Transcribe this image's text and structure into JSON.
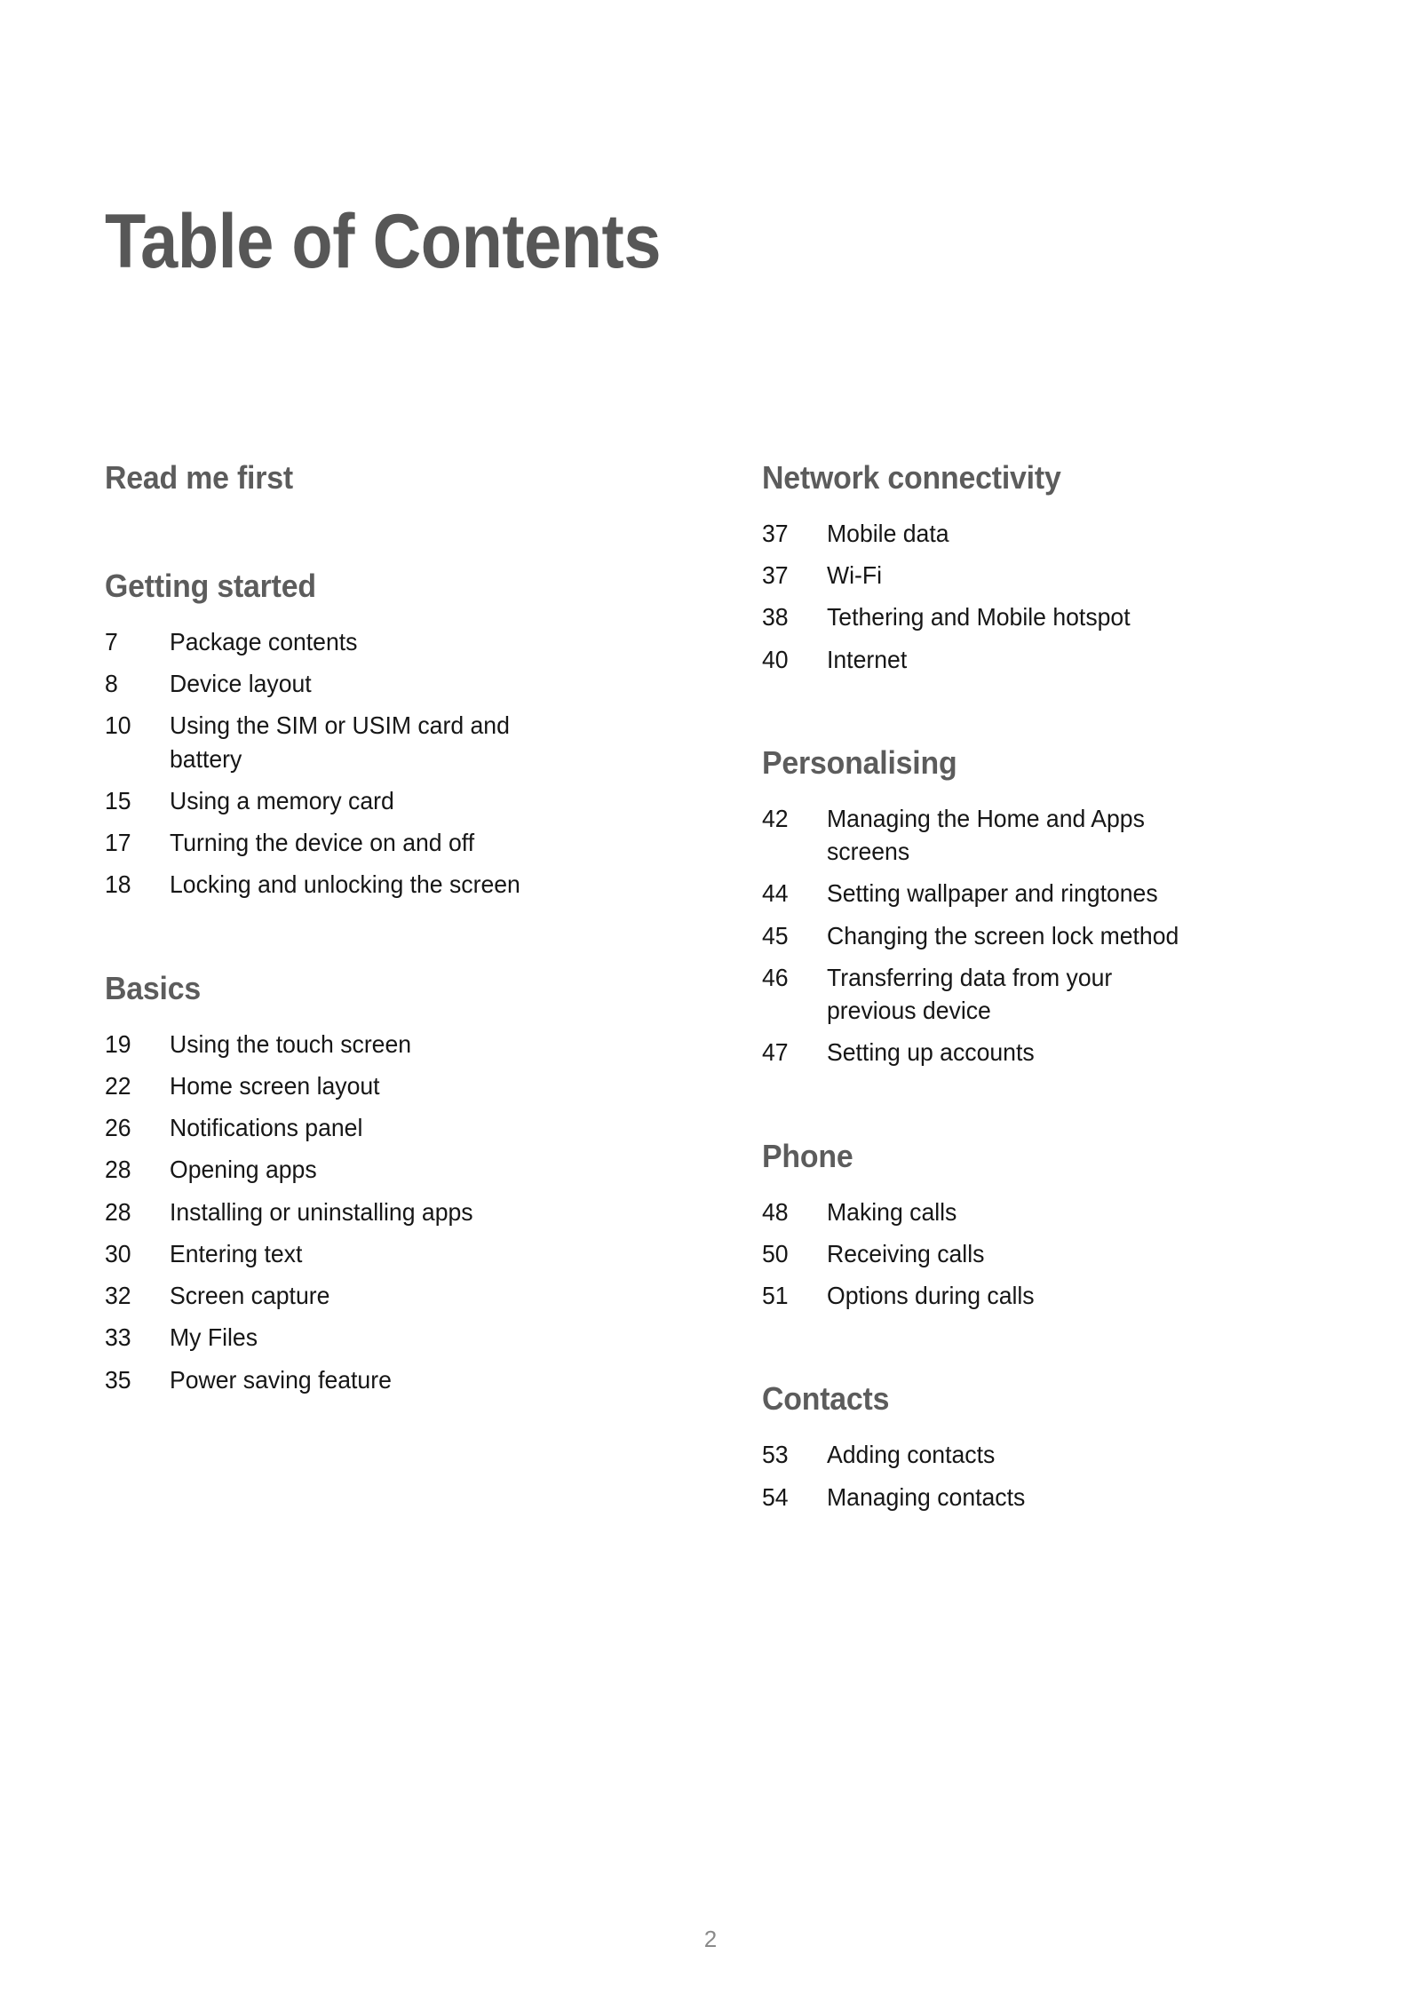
{
  "document": {
    "title": "Table of Contents",
    "page_number": "2",
    "heading_color": "#5c5c5c",
    "entry_color": "#161616",
    "page_number_color": "#8a8a8a",
    "background_color": "#ffffff"
  },
  "columns": [
    {
      "name": "left-column",
      "sections": [
        {
          "heading": "Read me first",
          "entries": []
        },
        {
          "heading": "Getting started",
          "entries": [
            {
              "page": "7",
              "label": "Package contents"
            },
            {
              "page": "8",
              "label": "Device layout"
            },
            {
              "page": "10",
              "label": "Using the SIM or USIM card and battery"
            },
            {
              "page": "15",
              "label": "Using a memory card"
            },
            {
              "page": "17",
              "label": "Turning the device on and off"
            },
            {
              "page": "18",
              "label": "Locking and unlocking the screen"
            }
          ]
        },
        {
          "heading": "Basics",
          "entries": [
            {
              "page": "19",
              "label": "Using the touch screen"
            },
            {
              "page": "22",
              "label": "Home screen layout"
            },
            {
              "page": "26",
              "label": "Notifications panel"
            },
            {
              "page": "28",
              "label": "Opening apps"
            },
            {
              "page": "28",
              "label": "Installing or uninstalling apps"
            },
            {
              "page": "30",
              "label": "Entering text"
            },
            {
              "page": "32",
              "label": "Screen capture"
            },
            {
              "page": "33",
              "label": "My Files"
            },
            {
              "page": "35",
              "label": "Power saving feature"
            }
          ]
        }
      ]
    },
    {
      "name": "right-column",
      "sections": [
        {
          "heading": "Network connectivity",
          "entries": [
            {
              "page": "37",
              "label": "Mobile data"
            },
            {
              "page": "37",
              "label": "Wi-Fi"
            },
            {
              "page": "38",
              "label": "Tethering and Mobile hotspot"
            },
            {
              "page": "40",
              "label": "Internet"
            }
          ]
        },
        {
          "heading": "Personalising",
          "entries": [
            {
              "page": "42",
              "label": "Managing the Home and Apps screens"
            },
            {
              "page": "44",
              "label": "Setting wallpaper and ringtones"
            },
            {
              "page": "45",
              "label": "Changing the screen lock method"
            },
            {
              "page": "46",
              "label": "Transferring data from your previous device"
            },
            {
              "page": "47",
              "label": "Setting up accounts"
            }
          ]
        },
        {
          "heading": "Phone",
          "entries": [
            {
              "page": "48",
              "label": "Making calls"
            },
            {
              "page": "50",
              "label": "Receiving calls"
            },
            {
              "page": "51",
              "label": "Options during calls"
            }
          ]
        },
        {
          "heading": "Contacts",
          "entries": [
            {
              "page": "53",
              "label": "Adding contacts"
            },
            {
              "page": "54",
              "label": "Managing contacts"
            }
          ]
        }
      ]
    }
  ]
}
